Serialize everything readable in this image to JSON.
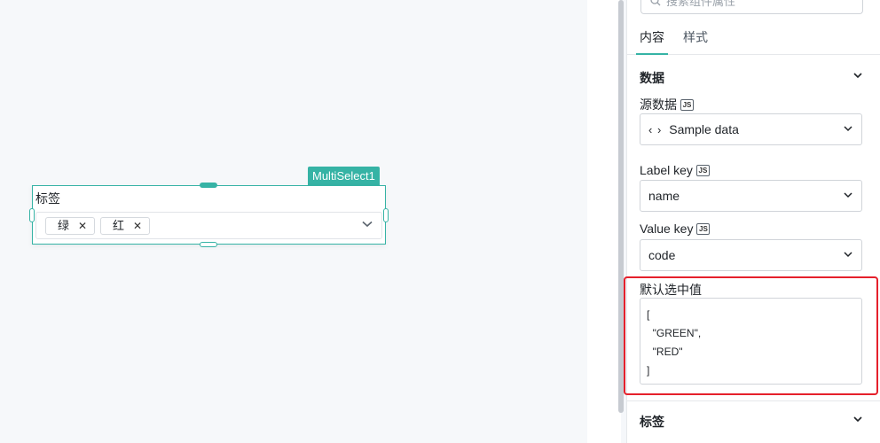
{
  "canvas": {
    "widget": {
      "tag": "MultiSelect1",
      "label": "标签",
      "chips": [
        {
          "label": "绿"
        },
        {
          "label": "红"
        }
      ]
    }
  },
  "panel": {
    "search": {
      "placeholder": "搜索组件属性"
    },
    "tabs": [
      {
        "label": "内容",
        "active": true
      },
      {
        "label": "样式",
        "active": false
      }
    ],
    "sections": {
      "data_title": "数据",
      "label_title": "标签"
    },
    "fields": {
      "source": {
        "label": "源数据",
        "badge": "JS",
        "value": "Sample data"
      },
      "label_key": {
        "label": "Label key",
        "badge": "JS",
        "value": "name"
      },
      "value_key": {
        "label": "Value key",
        "badge": "JS",
        "value": "code"
      },
      "default_value": {
        "label": "默认选中值",
        "value": "[\n  \"GREEN\",\n  \"RED\"\n]"
      }
    }
  },
  "colors": {
    "accent": "#36b3a5",
    "highlight": "#e5202b"
  }
}
